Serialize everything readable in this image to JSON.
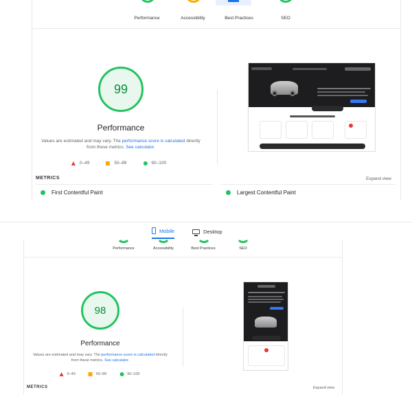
{
  "top_report": {
    "categories": [
      "Performance",
      "Accessibility",
      "Best Practices",
      "SEO"
    ],
    "score": "99",
    "title": "Performance",
    "note_prefix": "Values are estimated and may vary. The ",
    "note_link1": "performance score is calculated",
    "note_middle": " directly from these metrics. ",
    "note_link2": "See calculator.",
    "legend": [
      "0–49",
      "50–89",
      "90–100"
    ],
    "metrics_label": "METRICS",
    "expand_label": "Expand view",
    "metrics": [
      "First Contentful Paint",
      "Largest Contentful Paint"
    ]
  },
  "bottom_report": {
    "tabs": [
      "Mobile",
      "Desktop"
    ],
    "categories": [
      "Performance",
      "Accessibility",
      "Best Practices",
      "SEO"
    ],
    "score": "98",
    "title": "Performance",
    "note_prefix": "Values are estimated and may vary. The ",
    "note_link1": "performance score is calculated",
    "note_middle": " directly from these metrics. ",
    "note_link2": "See calculator.",
    "legend": [
      "0–49",
      "50–89",
      "90–100"
    ],
    "metrics_label": "METRICS",
    "expand_label": "Expand view"
  },
  "colors": {
    "pass": "#21c35e",
    "average": "#f9ab00",
    "fail": "#e53935",
    "link": "#1a73e8"
  },
  "icons": [
    "phone-icon",
    "monitor-icon",
    "triangle-icon",
    "square-icon",
    "circle-icon"
  ]
}
